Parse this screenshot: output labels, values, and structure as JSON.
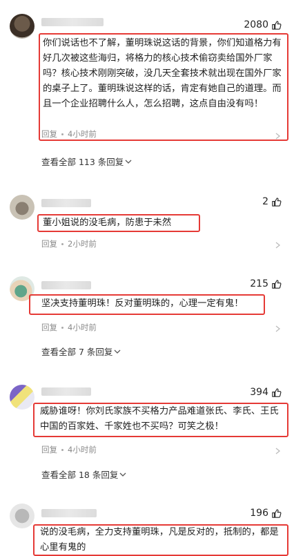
{
  "comments": [
    {
      "likes": "2080",
      "text": "你们说话也不了解，董明珠说这话的背景，你们知道格力有好几次被这些海归，将格力的核心技术偷窃卖给国外厂家吗？核心技术刚刚突破，没几天全套技术就出现在国外厂家的桌子上了。董明珠说这样的话，肯定有她自己的道理。而且一个企业招聘什么人，怎么招聘，这点自由没有吗！",
      "reply_label": "回复",
      "time": "4小时前",
      "view_replies": "查看全部 113 条回复"
    },
    {
      "likes": "2",
      "text": "董小姐说的没毛病，防患于未然",
      "reply_label": "回复",
      "time": "2小时前"
    },
    {
      "likes": "215",
      "text": "坚决支持董明珠！反对董明珠的，心理一定有鬼！",
      "reply_label": "回复",
      "time": "4小时前",
      "view_replies": "查看全部 7 条回复"
    },
    {
      "likes": "394",
      "text": "威胁谁呀！你刘氏家族不买格力产品难道张氏、李氏、王氏中国的百家姓、千家姓也不买吗？可笑之极！",
      "reply_label": "回复",
      "time": "4小时前",
      "view_replies": "查看全部 18 条回复"
    },
    {
      "likes": "196",
      "text": "说的没毛病，全力支持董明珠，凡是反对的，抵制的，都是心里有鬼的"
    }
  ]
}
